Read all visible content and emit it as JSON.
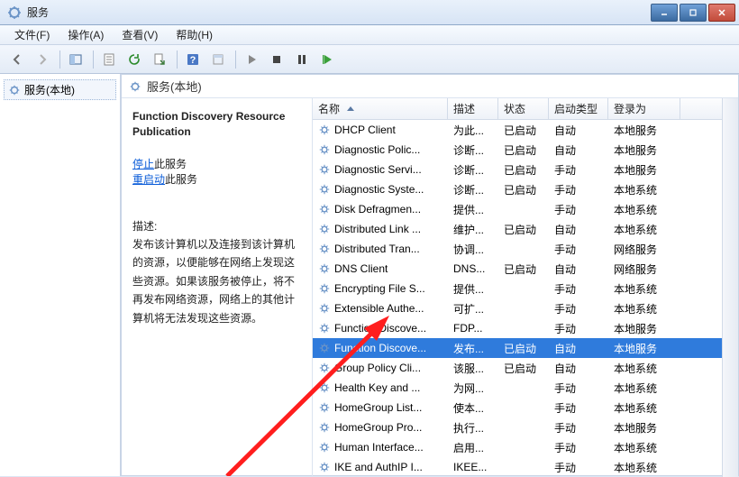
{
  "window": {
    "title": "服务"
  },
  "menu": {
    "file": "文件(F)",
    "action": "操作(A)",
    "view": "查看(V)",
    "help": "帮助(H)"
  },
  "tree": {
    "root": "服务(本地)"
  },
  "header": {
    "title": "服务(本地)"
  },
  "detail": {
    "title": "Function Discovery Resource Publication",
    "stop_link": "停止",
    "stop_suffix": "此服务",
    "restart_link": "重启动",
    "restart_suffix": "此服务",
    "desc_label": "描述:",
    "desc_body": "发布该计算机以及连接到该计算机的资源，以便能够在网络上发现这些资源。如果该服务被停止，将不再发布网络资源，网络上的其他计算机将无法发现这些资源。"
  },
  "columns": {
    "name": "名称",
    "desc": "描述",
    "status": "状态",
    "startup": "启动类型",
    "logon": "登录为"
  },
  "rows": [
    {
      "name": "DHCP Client",
      "desc": "为此...",
      "status": "已启动",
      "startup": "自动",
      "logon": "本地服务"
    },
    {
      "name": "Diagnostic Polic...",
      "desc": "诊断...",
      "status": "已启动",
      "startup": "自动",
      "logon": "本地服务"
    },
    {
      "name": "Diagnostic Servi...",
      "desc": "诊断...",
      "status": "已启动",
      "startup": "手动",
      "logon": "本地服务"
    },
    {
      "name": "Diagnostic Syste...",
      "desc": "诊断...",
      "status": "已启动",
      "startup": "手动",
      "logon": "本地系统"
    },
    {
      "name": "Disk Defragmen...",
      "desc": "提供...",
      "status": "",
      "startup": "手动",
      "logon": "本地系统"
    },
    {
      "name": "Distributed Link ...",
      "desc": "维护...",
      "status": "已启动",
      "startup": "自动",
      "logon": "本地系统"
    },
    {
      "name": "Distributed Tran...",
      "desc": "协调...",
      "status": "",
      "startup": "手动",
      "logon": "网络服务"
    },
    {
      "name": "DNS Client",
      "desc": "DNS...",
      "status": "已启动",
      "startup": "自动",
      "logon": "网络服务"
    },
    {
      "name": "Encrypting File S...",
      "desc": "提供...",
      "status": "",
      "startup": "手动",
      "logon": "本地系统"
    },
    {
      "name": "Extensible Authe...",
      "desc": "可扩...",
      "status": "",
      "startup": "手动",
      "logon": "本地系统"
    },
    {
      "name": "Function Discove...",
      "desc": "FDP...",
      "status": "",
      "startup": "手动",
      "logon": "本地服务"
    },
    {
      "name": "Function Discove...",
      "desc": "发布...",
      "status": "已启动",
      "startup": "自动",
      "logon": "本地服务",
      "selected": true
    },
    {
      "name": "Group Policy Cli...",
      "desc": "该服...",
      "status": "已启动",
      "startup": "自动",
      "logon": "本地系统"
    },
    {
      "name": "Health Key and ...",
      "desc": "为网...",
      "status": "",
      "startup": "手动",
      "logon": "本地系统"
    },
    {
      "name": "HomeGroup List...",
      "desc": "使本...",
      "status": "",
      "startup": "手动",
      "logon": "本地系统"
    },
    {
      "name": "HomeGroup Pro...",
      "desc": "执行...",
      "status": "",
      "startup": "手动",
      "logon": "本地服务"
    },
    {
      "name": "Human Interface...",
      "desc": "启用...",
      "status": "",
      "startup": "手动",
      "logon": "本地系统"
    },
    {
      "name": "IKE and AuthIP I...",
      "desc": "IKEE...",
      "status": "",
      "startup": "手动",
      "logon": "本地系统"
    }
  ]
}
